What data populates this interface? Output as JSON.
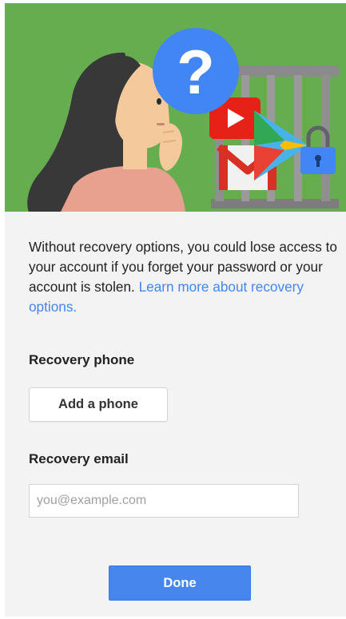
{
  "hero": {
    "question_mark": "?"
  },
  "intro": {
    "text": "Without recovery options, you could lose access to your account if you forget your password or your account is stolen.",
    "link_text": "Learn more about recovery options."
  },
  "recovery_phone": {
    "label": "Recovery phone",
    "button_label": "Add a phone"
  },
  "recovery_email": {
    "label": "Recovery email",
    "placeholder": "you@example.com",
    "value": ""
  },
  "done_button": {
    "label": "Done"
  },
  "colors": {
    "hero_background": "#66ad4f",
    "panel_background": "#f3f3f3",
    "link": "#4285f4",
    "primary_button": "#4787ed",
    "question_bubble": "#4285f4"
  },
  "icons": [
    "question-mark-icon",
    "youtube-icon",
    "play-store-icon",
    "gmail-icon",
    "padlock-icon"
  ]
}
